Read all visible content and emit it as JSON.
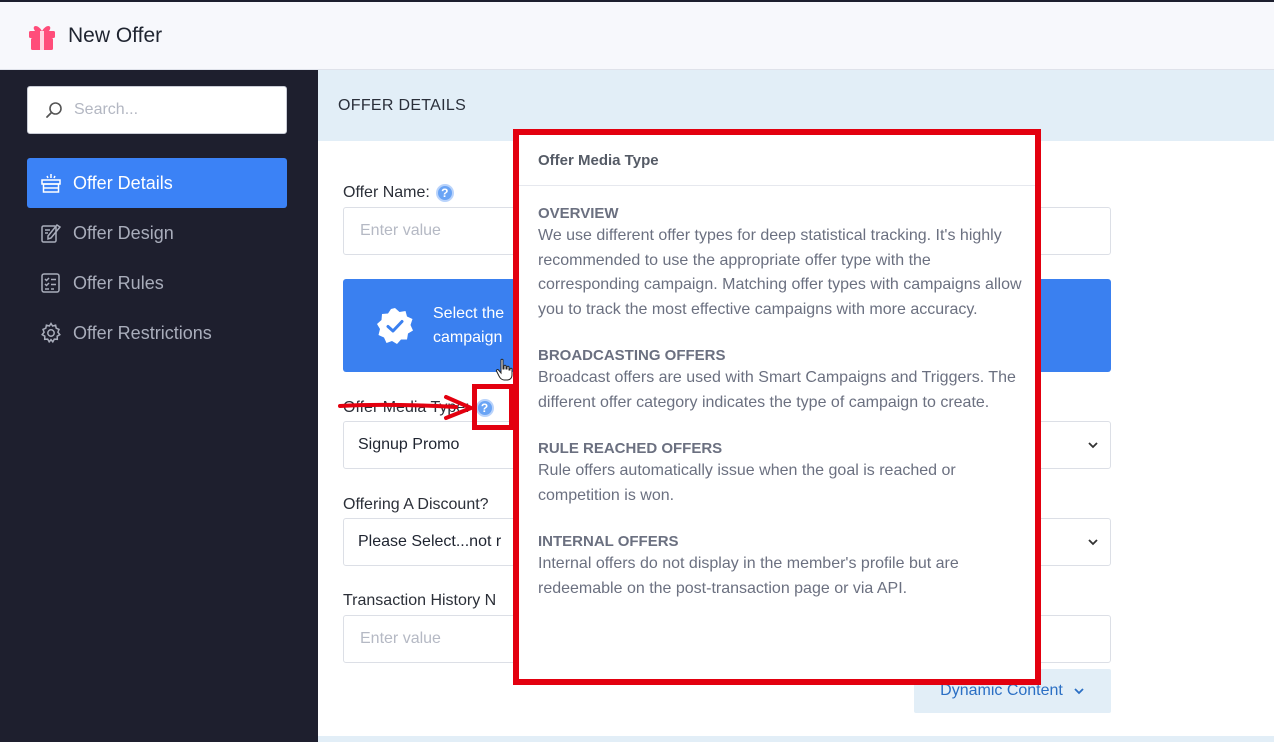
{
  "header": {
    "title": "New Offer",
    "icon": "gift-icon"
  },
  "sidebar": {
    "search_placeholder": "Search...",
    "items": [
      {
        "label": "Offer Details",
        "icon": "gift-box-icon",
        "active": true
      },
      {
        "label": "Offer Design",
        "icon": "design-icon",
        "active": false
      },
      {
        "label": "Offer Rules",
        "icon": "checklist-icon",
        "active": false
      },
      {
        "label": "Offer Restrictions",
        "icon": "gear-icon",
        "active": false
      }
    ]
  },
  "main": {
    "section_title": "OFFER DETAILS",
    "offer_name_label": "Offer Name:",
    "offer_name_placeholder": "Enter value",
    "banner_text": "Select the campaign",
    "media_type_label": "Offer Media Type:",
    "media_type_value": "Signup Promo",
    "discount_label": "Offering A Discount?",
    "discount_value": "Please Select...not r",
    "history_label": "Transaction History N",
    "history_placeholder": "Enter value",
    "dynamic_content_label": "Dynamic Content"
  },
  "popover": {
    "title": "Offer Media Type",
    "sections": [
      {
        "heading": "OVERVIEW",
        "text": "We use different offer types for deep statistical tracking. It's highly recommended to use the appropriate offer type with the corresponding campaign. Matching offer types with campaigns allow you to track the most effective campaigns with more accuracy."
      },
      {
        "heading": "BROADCASTING OFFERS",
        "text": "Broadcast offers are used with Smart Campaigns and Triggers. The different offer category indicates the type of campaign to create."
      },
      {
        "heading": "RULE REACHED OFFERS",
        "text": "Rule offers automatically issue when the goal is reached or competition is won."
      },
      {
        "heading": "INTERNAL OFFERS",
        "text": "Internal offers do not display in the member's profile but are redeemable on the post-transaction page or via API."
      }
    ]
  },
  "colors": {
    "accent": "#3b82f6",
    "sidebar_bg": "#1e1f2e",
    "highlight": "#e3000f",
    "section_bg": "#e2eef7"
  }
}
